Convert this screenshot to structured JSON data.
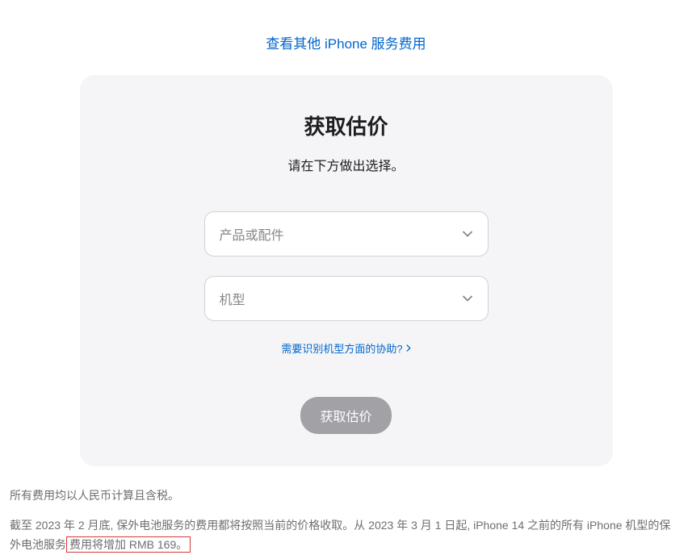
{
  "topLink": "查看其他 iPhone 服务费用",
  "card": {
    "title": "获取估价",
    "subtitle": "请在下方做出选择。",
    "select1Placeholder": "产品或配件",
    "select2Placeholder": "机型",
    "helpLink": "需要识别机型方面的协助?",
    "submitLabel": "获取估价"
  },
  "footnote1": "所有费用均以人民币计算且含税。",
  "footnote2_part1": "截至 2023 年 2 月底, 保外电池服务的费用都将按照当前的价格收取。从 2023 年 3 月 1 日起, iPhone 14 之前的所有 iPhone 机型的保外电池服务",
  "footnote2_highlight": "费用将增加 RMB 169。"
}
